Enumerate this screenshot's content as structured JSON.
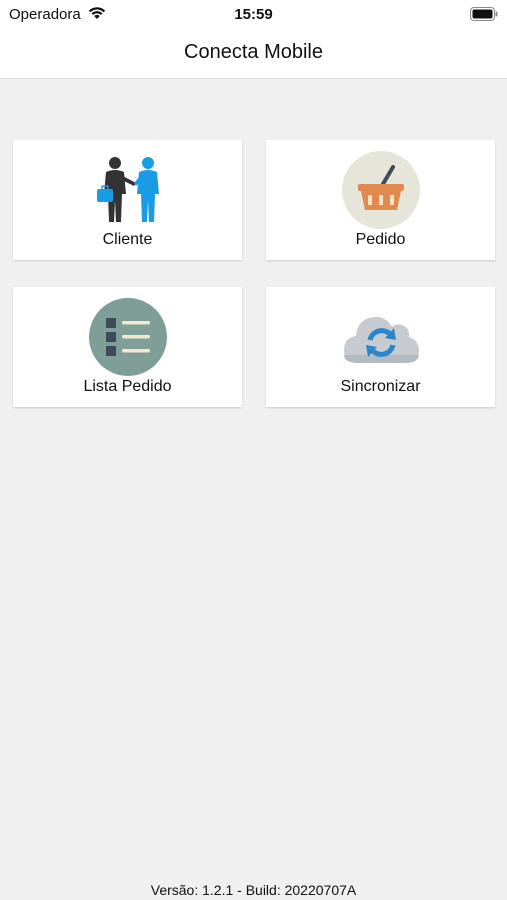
{
  "status_bar": {
    "carrier": "Operadora",
    "time": "15:59",
    "wifi_icon": "wifi-icon",
    "battery_icon": "battery-icon"
  },
  "header": {
    "title": "Conecta Mobile"
  },
  "menu": {
    "items": [
      {
        "label": "Cliente",
        "icon": "client-handshake-icon"
      },
      {
        "label": "Pedido",
        "icon": "shopping-basket-icon"
      },
      {
        "label": "Lista Pedido",
        "icon": "list-icon"
      },
      {
        "label": "Sincronizar",
        "icon": "cloud-sync-icon"
      }
    ]
  },
  "footer": {
    "version": "Versão: 1.2.1 - Build: 20220707A"
  },
  "colors": {
    "background": "#f0f0f0",
    "tile": "#ffffff",
    "person_dark": "#333333",
    "person_blue": "#1a9be6",
    "basket_bg": "#e5e5d9",
    "basket_orange": "#e08a4f",
    "list_bg": "#7f9e98",
    "cloud_gray": "#c5cbd1",
    "sync_blue": "#2a86c8"
  }
}
